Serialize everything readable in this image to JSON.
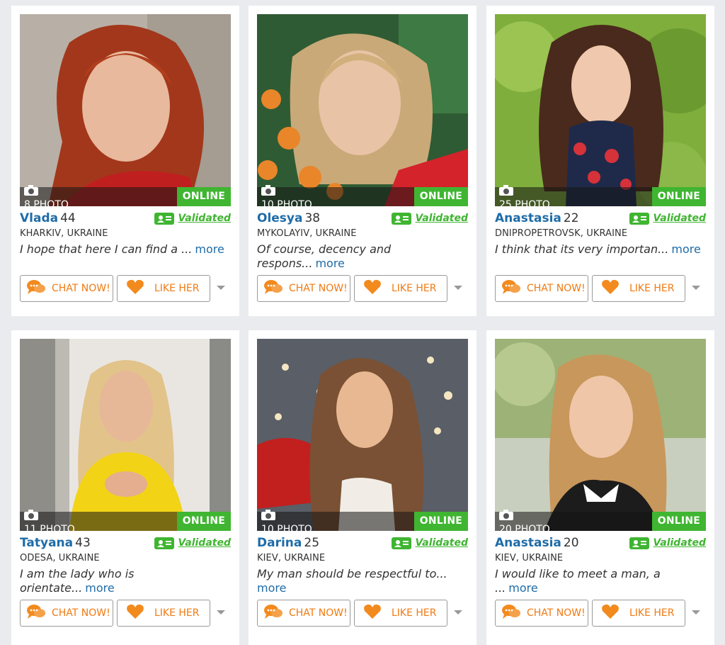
{
  "profiles": [
    {
      "name": "Vlada",
      "age": "44",
      "photos": "8 PHOTO",
      "status": "ONLINE",
      "validated": "Validated",
      "location": "KHARKIV, UKRAINE",
      "bio": "I hope that here I can find a ...",
      "more": "more",
      "chat": "CHAT NOW!",
      "like": "LIKE HER"
    },
    {
      "name": "Olesya",
      "age": "38",
      "photos": "10 PHOTO",
      "status": "ONLINE",
      "validated": "Validated",
      "location": "MYKOLAYIV, UKRAINE",
      "bio": "Of course, decency and respons...",
      "more": "more",
      "chat": "CHAT NOW!",
      "like": "LIKE HER"
    },
    {
      "name": "Anastasia",
      "age": "22",
      "photos": "25 PHOTO",
      "status": "ONLINE",
      "validated": "Validated",
      "location": "DNIPROPETROVSK, UKRAINE",
      "bio": "I think that its very importan...",
      "more": "more",
      "chat": "CHAT NOW!",
      "like": "LIKE HER"
    },
    {
      "name": "Tatyana",
      "age": "43",
      "photos": "11 PHOTO",
      "status": "ONLINE",
      "validated": "Validated",
      "location": "ODESA, UKRAINE",
      "bio": "I am the lady who is orientate...",
      "more": "more",
      "chat": "CHAT NOW!",
      "like": "LIKE HER"
    },
    {
      "name": "Darina",
      "age": "25",
      "photos": "10 PHOTO",
      "status": "ONLINE",
      "validated": "Validated",
      "location": "KIEV, UKRAINE",
      "bio": "My man should be respectful to...",
      "more": "more",
      "chat": "CHAT NOW!",
      "like": "LIKE HER"
    },
    {
      "name": "Anastasia",
      "age": "20",
      "photos": "20 PHOTO",
      "status": "ONLINE",
      "validated": "Validated",
      "location": "KIEV, UKRAINE",
      "bio": "I would like to meet a man, a ...",
      "more": "more",
      "chat": "CHAT NOW!",
      "like": "LIKE HER"
    }
  ],
  "icons": {
    "camera": "camera-icon",
    "validated": "id-card-icon",
    "chat": "chat-bubbles-icon",
    "like": "heart-icon",
    "dropdown": "chevron-down-icon"
  },
  "colors": {
    "name": "#1f6ca8",
    "online": "#3fb531",
    "validated": "#3fb531",
    "button_text": "#f07a12",
    "chat_icon": "#f28a1e",
    "like_icon": "#f28a1e"
  }
}
